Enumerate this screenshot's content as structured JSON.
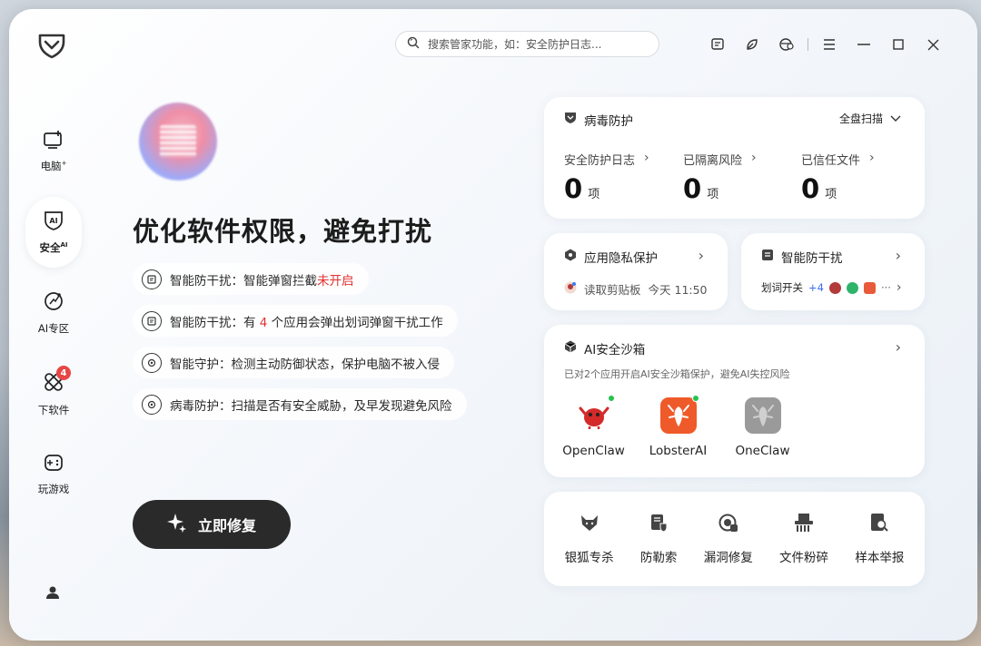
{
  "header": {
    "search_placeholder": "搜索管家功能，如：安全防护日志..."
  },
  "sidebar": {
    "items": [
      {
        "label": "电脑",
        "sup": "+",
        "icon": "computer-add-icon"
      },
      {
        "label": "安全",
        "sup": "AI",
        "icon": "ai-shield-icon",
        "active": true
      },
      {
        "label": "AI专区",
        "icon": "ai-zone-icon"
      },
      {
        "label": "下软件",
        "icon": "software-download-icon",
        "badge": "4"
      },
      {
        "label": "玩游戏",
        "icon": "gamepad-icon"
      }
    ]
  },
  "hero": {
    "title": "优化软件权限，避免打扰",
    "issues": [
      {
        "prefix": "智能防干扰：智能弹窗拦截",
        "highlight": "未开启",
        "suffix": ""
      },
      {
        "prefix": "智能防干扰：有 ",
        "highlight": "4",
        "suffix": " 个应用会弹出划词弹窗干扰工作"
      },
      {
        "prefix": "智能守护：检测主动防御状态，保护电脑不被入侵",
        "highlight": "",
        "suffix": ""
      },
      {
        "prefix": "病毒防护：扫描是否有安全威胁，及早发现避免风险",
        "highlight": "",
        "suffix": ""
      }
    ],
    "fix_button": "立即修复"
  },
  "virus_card": {
    "title": "病毒防护",
    "scan_label": "全盘扫描",
    "stats": [
      {
        "label": "安全防护日志",
        "value": "0",
        "unit": "项"
      },
      {
        "label": "已隔离风险",
        "value": "0",
        "unit": "项"
      },
      {
        "label": "已信任文件",
        "value": "0",
        "unit": "项"
      }
    ]
  },
  "privacy_card": {
    "title": "应用隐私保护",
    "row_text": "读取剪贴板",
    "row_time": "今天 11:50"
  },
  "interference_card": {
    "title": "智能防干扰",
    "row_label": "划词开关",
    "row_count": "+4",
    "row_more": "···"
  },
  "sandbox_card": {
    "title": "AI安全沙箱",
    "description": "已对2个应用开启AI安全沙箱保护，避免AI失控风险",
    "apps": [
      {
        "name": "OpenClaw",
        "active": true
      },
      {
        "name": "LobsterAI",
        "active": true
      },
      {
        "name": "OneClaw",
        "active": false
      }
    ]
  },
  "tools": [
    {
      "label": "银狐专杀",
      "icon": "fox-icon"
    },
    {
      "label": "防勒索",
      "icon": "anti-ransom-icon"
    },
    {
      "label": "漏洞修复",
      "icon": "vulnerability-fix-icon"
    },
    {
      "label": "文件粉碎",
      "icon": "file-shredder-icon"
    },
    {
      "label": "样本举报",
      "icon": "sample-report-icon"
    }
  ],
  "colors": {
    "accent_red": "#e0312f",
    "dark_button": "#2a2a2a",
    "status_green": "#26c24f",
    "badge_red": "#e84545"
  }
}
